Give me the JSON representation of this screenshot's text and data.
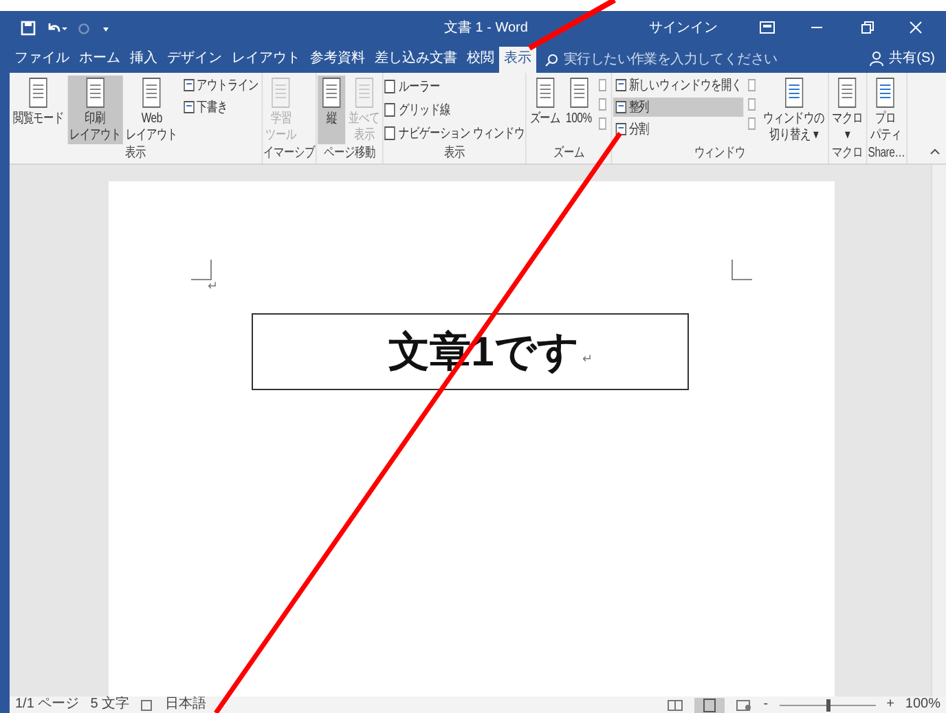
{
  "window": {
    "title": "文書 1 - Word",
    "signin": "サインイン"
  },
  "tabs": [
    {
      "label": "ファイル",
      "selected": false
    },
    {
      "label": "ホーム",
      "selected": false
    },
    {
      "label": "挿入",
      "selected": false
    },
    {
      "label": "デザイン",
      "selected": false
    },
    {
      "label": "レイアウト",
      "selected": false
    },
    {
      "label": "参考資料",
      "selected": false
    },
    {
      "label": "差し込み文書",
      "selected": false
    },
    {
      "label": "校閲",
      "selected": false
    },
    {
      "label": "表示",
      "selected": true
    }
  ],
  "tell_me": {
    "placeholder": "実行したい作業を入力してください"
  },
  "share": "共有(S)",
  "ribbon": [
    {
      "label": "表示",
      "items": [
        {
          "kind": "large",
          "lines": [
            "閲覧モード"
          ],
          "selected": false,
          "disabled": false
        },
        {
          "kind": "large",
          "lines": [
            "印刷",
            "レイアウト"
          ],
          "selected": true,
          "disabled": false
        },
        {
          "kind": "large",
          "lines": [
            "Web",
            "レイアウト"
          ],
          "selected": false,
          "disabled": false
        },
        {
          "kind": "smalls",
          "entries": [
            {
              "label": "アウトライン"
            },
            {
              "label": "下書き"
            }
          ]
        }
      ]
    },
    {
      "label": "イマーシブ",
      "items": [
        {
          "kind": "large",
          "lines": [
            "学習",
            "ツール"
          ],
          "selected": false,
          "disabled": true
        }
      ]
    },
    {
      "label": "ページ移動",
      "items": [
        {
          "kind": "large",
          "lines": [
            "縦"
          ],
          "selected": true,
          "disabled": false
        },
        {
          "kind": "large",
          "lines": [
            "並べて",
            "表示"
          ],
          "selected": false,
          "disabled": true
        }
      ]
    },
    {
      "label": "表示",
      "items": [
        {
          "kind": "checks",
          "entries": [
            {
              "label": "ルーラー",
              "checked": false
            },
            {
              "label": "グリッド線",
              "checked": false
            },
            {
              "label": "ナビゲーション ウィンドウ",
              "checked": false
            }
          ]
        }
      ]
    },
    {
      "label": "ズーム",
      "items": [
        {
          "kind": "large",
          "lines": [
            "ズーム"
          ],
          "selected": false,
          "disabled": false
        },
        {
          "kind": "large",
          "lines": [
            "100%"
          ],
          "selected": false,
          "disabled": false
        },
        {
          "kind": "iconcol"
        }
      ]
    },
    {
      "label": "ウィンドウ",
      "items": [
        {
          "kind": "smalls",
          "entries": [
            {
              "label": "新しいウィンドウを開く",
              "selected": false
            },
            {
              "label": "整列",
              "selected": true
            },
            {
              "label": "分割",
              "selected": false
            }
          ]
        },
        {
          "kind": "iconcol"
        },
        {
          "kind": "large",
          "lines": [
            "ウィンドウの",
            "切り替え ▾"
          ],
          "selected": false,
          "disabled": false
        }
      ]
    },
    {
      "label": "マクロ",
      "items": [
        {
          "kind": "large",
          "lines": [
            "マクロ",
            "▾"
          ],
          "selected": false,
          "disabled": false
        }
      ]
    },
    {
      "label": "Share…",
      "items": [
        {
          "kind": "large",
          "lines": [
            "プロ",
            "パティ"
          ],
          "selected": false,
          "disabled": false
        }
      ]
    }
  ],
  "document": {
    "mark": "↵",
    "heading": "文章1です",
    "heading_mark": "↵"
  },
  "status_bar": {
    "page": "1/1 ページ",
    "words": "5 文字",
    "language": "日本語",
    "zoom_minus": "-",
    "zoom_plus": "+",
    "zoom": "100%",
    "zoom_slider": {
      "level": 0.5
    }
  }
}
